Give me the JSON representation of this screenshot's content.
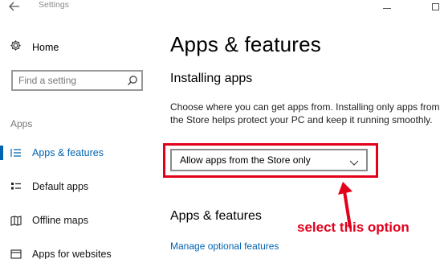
{
  "window": {
    "title": "Settings",
    "back_icon": "back-arrow-icon",
    "controls": [
      "minimize-icon",
      "maximize-icon"
    ]
  },
  "sidebar": {
    "home_label": "Home",
    "home_icon": "gear-icon",
    "search": {
      "placeholder": "Find a setting",
      "value": "",
      "icon": "search-icon"
    },
    "section_label": "Apps",
    "items": [
      {
        "label": "Apps & features",
        "icon": "list-icon",
        "active": true
      },
      {
        "label": "Default apps",
        "icon": "default-apps-icon",
        "active": false
      },
      {
        "label": "Offline maps",
        "icon": "map-icon",
        "active": false
      },
      {
        "label": "Apps for websites",
        "icon": "web-apps-icon",
        "active": false
      }
    ]
  },
  "main": {
    "title": "Apps & features",
    "installing": {
      "heading": "Installing apps",
      "description": "Choose where you can get apps from. Installing only apps from the Store helps protect your PC and keep it running smoothly.",
      "dropdown_value": "Allow apps from the Store only"
    },
    "section2_heading": "Apps & features",
    "manage_link": "Manage optional features"
  },
  "annotation": {
    "text": "select this option",
    "color": "#e3001b"
  },
  "colors": {
    "accent": "#0063b1",
    "highlight": "#e3001b"
  }
}
